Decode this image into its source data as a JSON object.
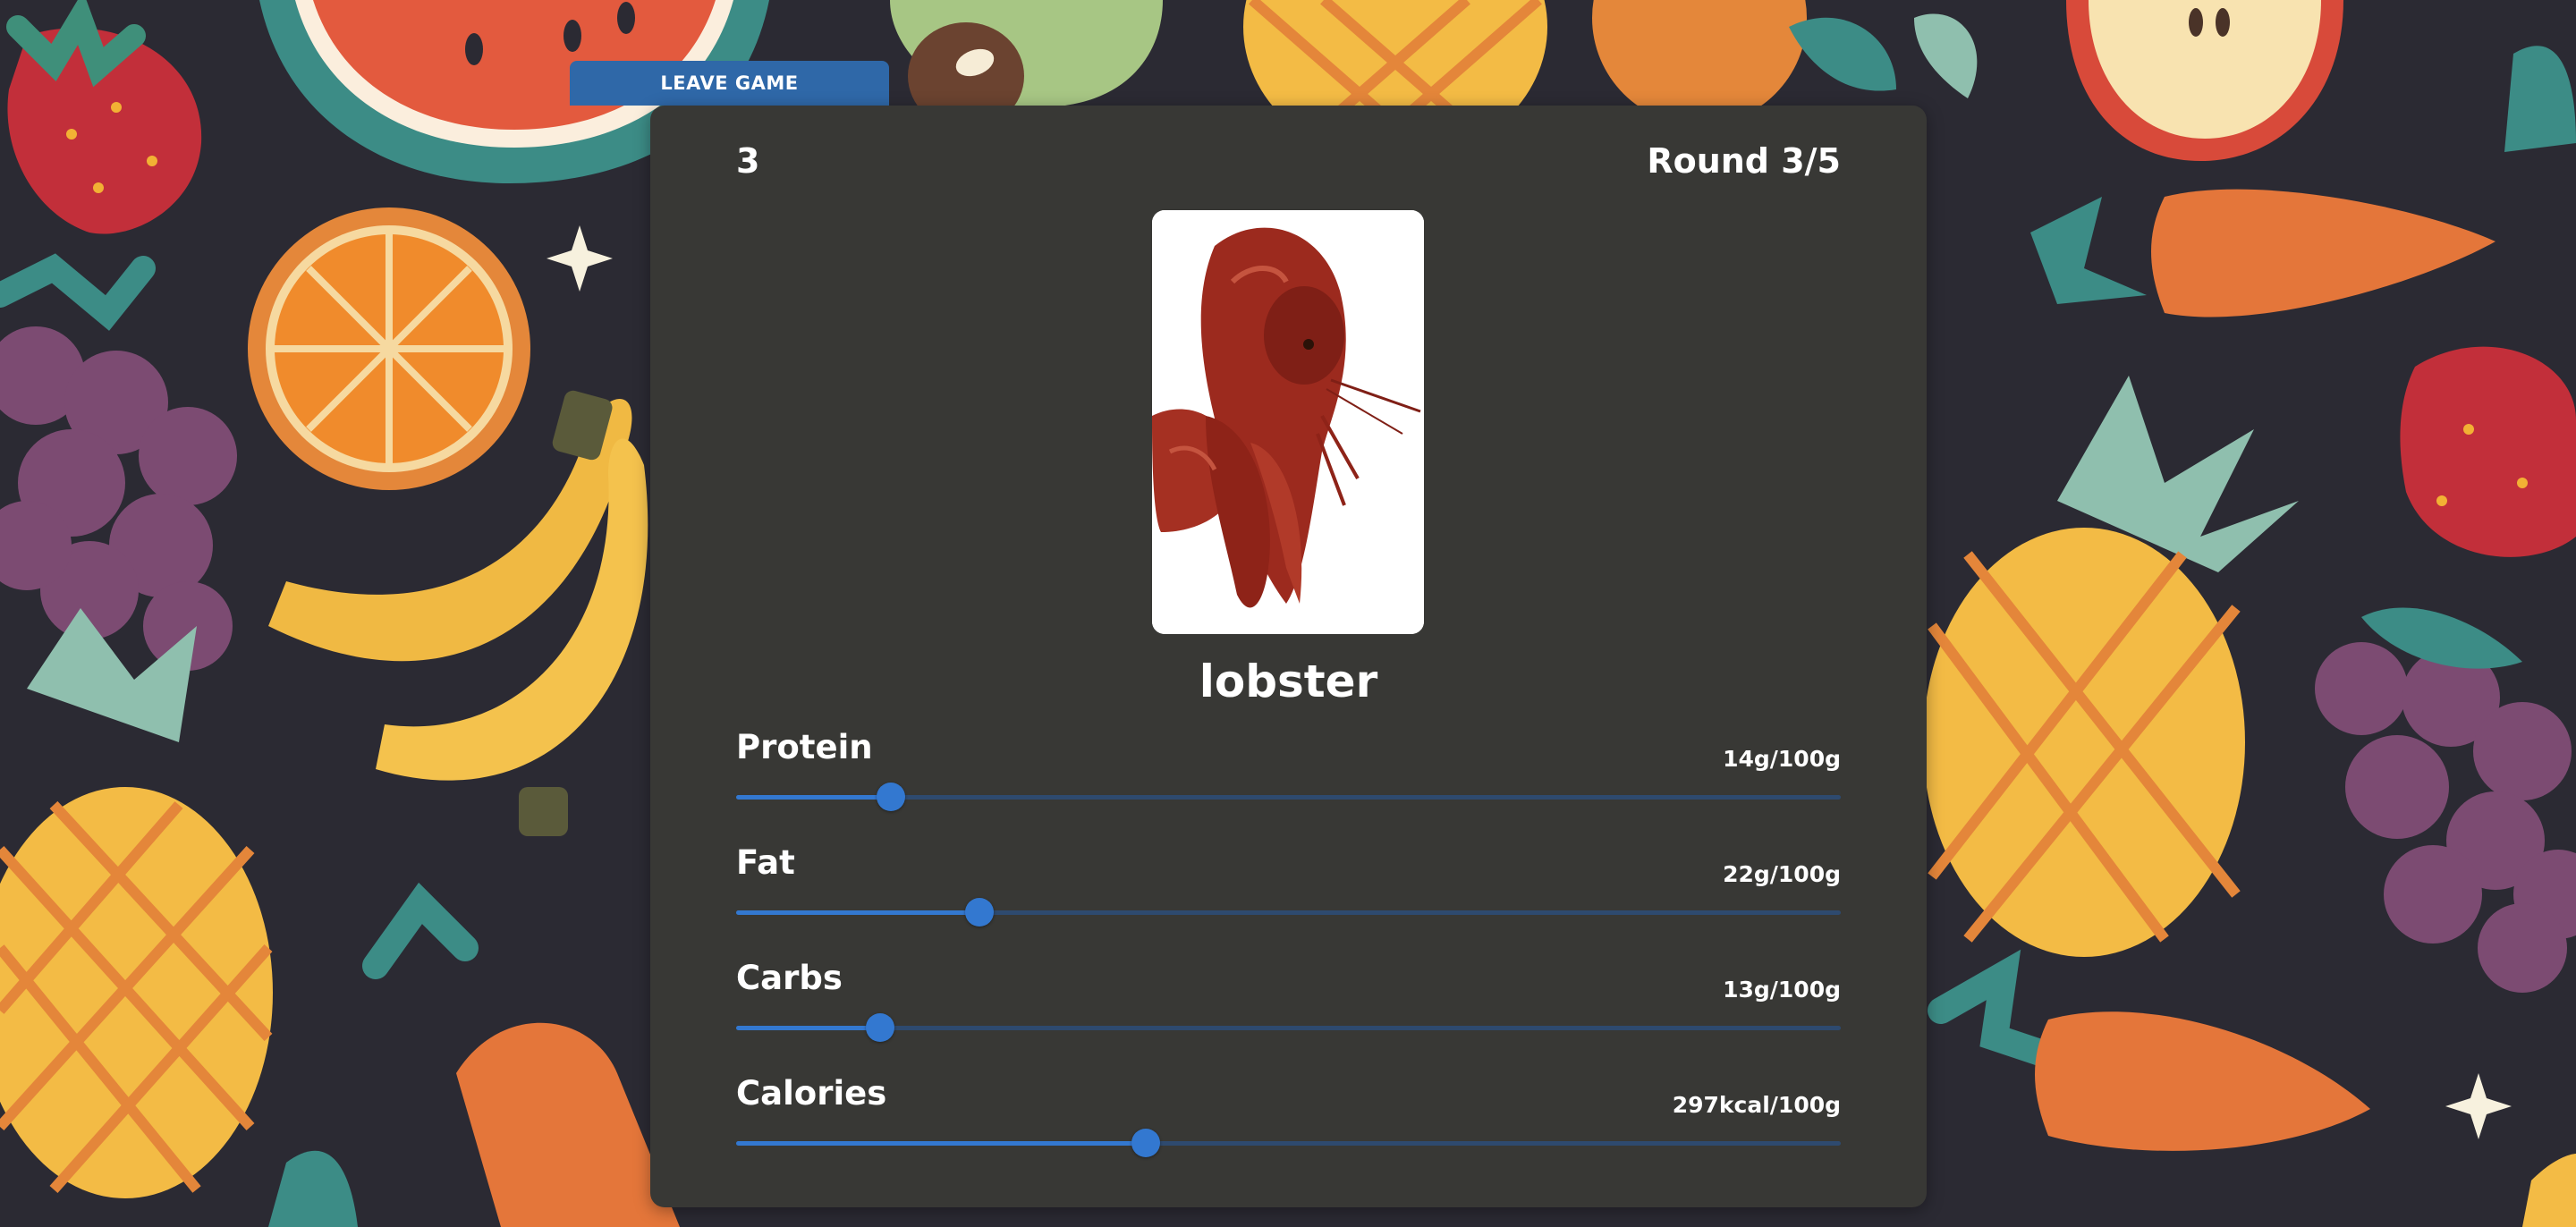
{
  "game": {
    "leave_label": "LEAVE GAME",
    "score": "3",
    "round": "Round 3/5"
  },
  "food": {
    "name": "lobster",
    "image_icon": "lobster-photo"
  },
  "nutrients": [
    {
      "label": "Protein",
      "value": "14g/100g",
      "level": 0.14
    },
    {
      "label": "Fat",
      "value": "22g/100g",
      "level": 0.22
    },
    {
      "label": "Carbs",
      "value": "13g/100g",
      "level": 0.13
    },
    {
      "label": "Calories",
      "value": "297kcal/100g",
      "level": 0.371
    }
  ],
  "colors": {
    "accent": "#3378d0",
    "card": "#383835",
    "background": "#2b2a33"
  }
}
